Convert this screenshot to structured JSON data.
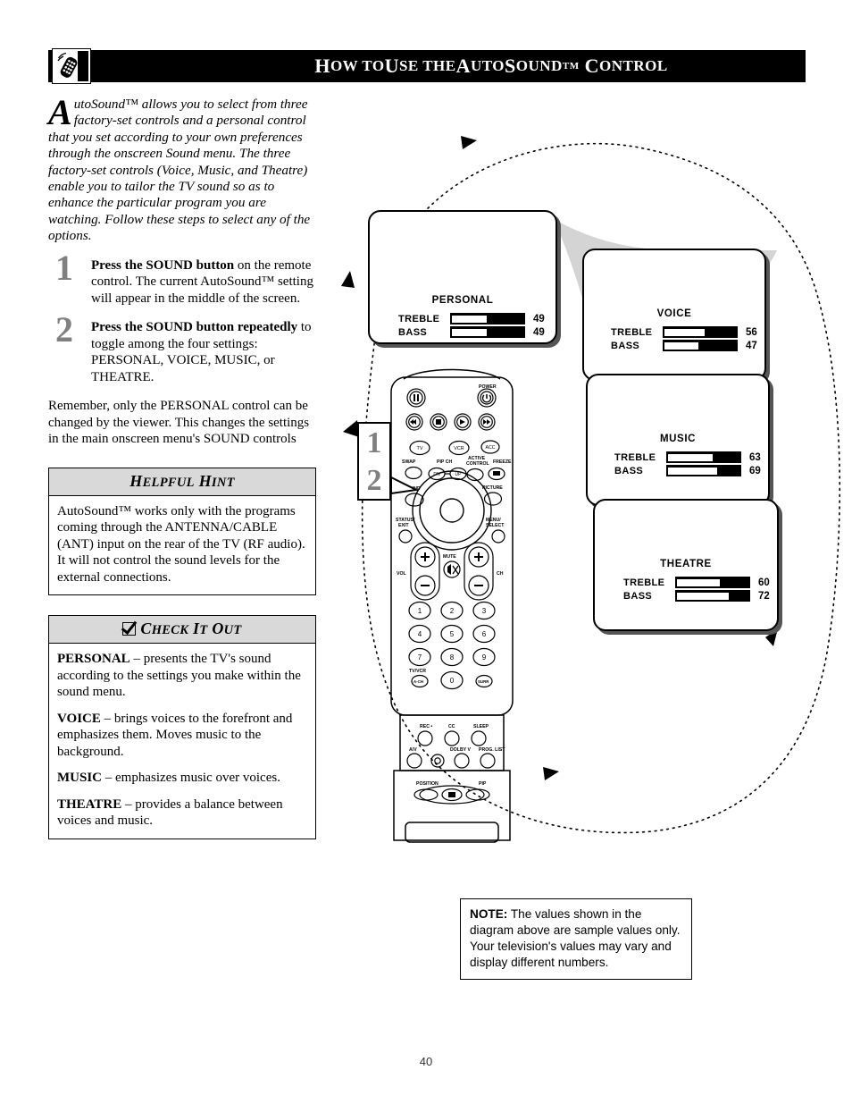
{
  "header": {
    "icon": "remote-control-icon",
    "title_parts": [
      "H",
      "OW TO ",
      "U",
      "SE THE ",
      "A",
      "UTO",
      "S",
      "OUND",
      "TM",
      " C",
      "ONTROL"
    ],
    "title_plain": "How to Use the AutoSound™ Control"
  },
  "intro": {
    "dropcap": "A",
    "text": "utoSound™ allows you to select from three factory-set controls and a personal control that you set according to your own preferences through the onscreen Sound menu. The three factory-set controls (Voice, Music, and Theatre) enable you to tailor the TV sound so as to enhance the particular program you are watching.  Follow these steps to select any of the options."
  },
  "steps": [
    {
      "number": "1",
      "bold_lead": "Press the SOUND button",
      "rest": " on the remote control.  The current AutoSound™ setting will appear in the middle of the screen."
    },
    {
      "number": "2",
      "bold_lead": "Press the SOUND button repeatedly",
      "rest": " to toggle among the four settings: PERSONAL, VOICE, MUSIC, or THEATRE."
    }
  ],
  "remember": "Remember, only the PERSONAL control can be changed by the viewer.  This changes the settings in the main onscreen menu's SOUND controls",
  "helpful_hint": {
    "title_first": "H",
    "title_rest": "ELPFUL ",
    "title_first2": "H",
    "title_rest2": "INT",
    "title_plain": "HELPFUL HINT",
    "body": "AutoSound™ works only with the programs coming through the ANTENNA/CABLE (ANT) input on the rear of the TV (RF audio).  It will not control the sound levels for the external connections."
  },
  "check_it_out": {
    "title_plain": "CHECK IT OUT",
    "icon": "checkbox-checked-icon",
    "items": [
      {
        "term": "PERSONAL",
        "desc": " – presents the TV's sound according to the settings you make within the sound menu."
      },
      {
        "term": "VOICE",
        "desc": " – brings voices to the forefront and emphasizes them. Moves music to the background."
      },
      {
        "term": "MUSIC",
        "desc": " – emphasizes music over voices."
      },
      {
        "term": "THEATRE",
        "desc": " – provides a balance between voices and music."
      }
    ]
  },
  "diagram": {
    "panels": [
      {
        "id": "personal",
        "title": "PERSONAL",
        "rows": [
          {
            "label": "TREBLE",
            "value": "49",
            "percent": 49
          },
          {
            "label": "BASS",
            "value": "49",
            "percent": 49
          }
        ]
      },
      {
        "id": "voice",
        "title": "VOICE",
        "rows": [
          {
            "label": "TREBLE",
            "value": "56",
            "percent": 56
          },
          {
            "label": "BASS",
            "value": "47",
            "percent": 47
          }
        ]
      },
      {
        "id": "music",
        "title": "MUSIC",
        "rows": [
          {
            "label": "TREBLE",
            "value": "63",
            "percent": 63
          },
          {
            "label": "BASS",
            "value": "69",
            "percent": 69
          }
        ]
      },
      {
        "id": "theatre",
        "title": "THEATRE",
        "rows": [
          {
            "label": "TREBLE",
            "value": "60",
            "percent": 60
          },
          {
            "label": "BASS",
            "value": "72",
            "percent": 72
          }
        ]
      }
    ],
    "callout": {
      "line1": "1",
      "line2": "2"
    },
    "remote_labels": {
      "power": "POWER",
      "tv": "TV",
      "vcr": "VCR",
      "acc": "ACC",
      "swap": "SWAP",
      "pip_ch": "PIP CH",
      "dn": "DN",
      "up": "UP",
      "active_control": "ACTIVE CONTROL",
      "freeze": "FREEZE",
      "sound": "SOUND",
      "picture": "PICTURE",
      "status_exit": "STATUS/ EXIT",
      "menu_select": "MENU/ SELECT",
      "vol": "VOL",
      "mute": "MUTE",
      "ch": "CH",
      "tv_vcr": "TV/VCR",
      "ach": "A-CH",
      "surr": "SURR",
      "rec": "REC",
      "cc": "CC",
      "sleep": "SLEEP",
      "av": "A/V",
      "dolby": "DOLBY V",
      "prog_list": "PROG. LIST",
      "position": "POSITION",
      "pip": "PIP",
      "keys": [
        "1",
        "2",
        "3",
        "4",
        "5",
        "6",
        "7",
        "8",
        "9",
        "0"
      ]
    }
  },
  "note": {
    "label": "NOTE:",
    "text": " The values shown in the diagram above are sample values only. Your television's values may vary and display different numbers."
  },
  "page_number": "40",
  "colors": {
    "header_bg": "#000000",
    "header_fg": "#ffffff",
    "box_head_bg": "#d9d9d9",
    "step_num": "#808080",
    "swoosh": "#d4d4d4",
    "panel_shadow": "#555555"
  }
}
